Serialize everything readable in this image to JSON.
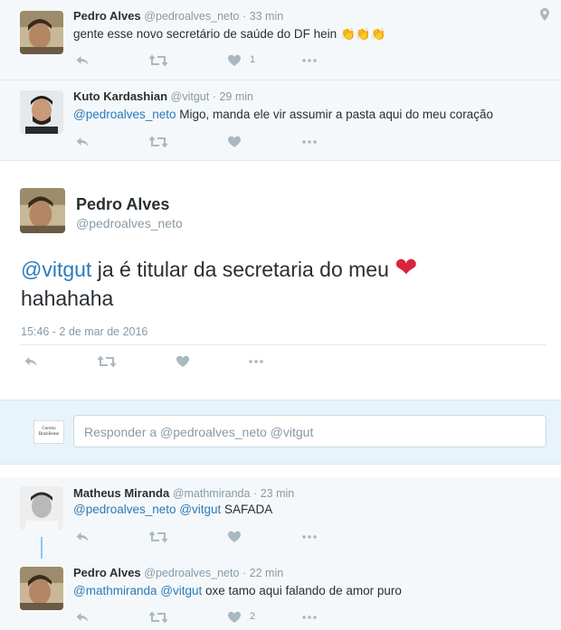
{
  "colors": {
    "link": "#2b7bb9",
    "muted": "#8899a6",
    "text": "#292f33",
    "heart": "#d9233f",
    "context_bg": "#f5f8fa"
  },
  "tweets": [
    {
      "name": "Pedro Alves",
      "handle": "@pedroalves_neto",
      "time": "· 33 min",
      "text": "gente esse novo secretário de saúde do DF hein",
      "emoji": "👏👏👏",
      "likes": "1",
      "has_location_icon": true
    },
    {
      "name": "Kuto Kardashian",
      "handle": "@vitgut",
      "time": "· 29 min",
      "mention": "@pedroalves_neto",
      "text": " Migo, manda ele vir assumir a pasta aqui do meu coração",
      "likes": ""
    }
  ],
  "focused": {
    "name": "Pedro Alves",
    "handle": "@pedroalves_neto",
    "mention": "@vitgut",
    "text_line1": " ja é titular da secretaria do meu",
    "text_line2": "hahahaha",
    "emoji": "❤",
    "date": "15:46 - 2 de mar de 2016"
  },
  "reply": {
    "brand": "Correio Braziliense",
    "placeholder": "Responder a @pedroalves_neto @vitgut"
  },
  "replies": [
    {
      "name": "Matheus Miranda",
      "handle": "@mathmiranda",
      "time": "· 23 min",
      "mention": "@pedroalves_neto @vitgut",
      "text": " SAFADA",
      "likes": ""
    },
    {
      "name": "Pedro Alves",
      "handle": "@pedroalves_neto",
      "time": "· 22 min",
      "mention": "@mathmiranda @vitgut",
      "text": " oxe tamo aqui falando de amor puro",
      "likes": "2"
    }
  ]
}
